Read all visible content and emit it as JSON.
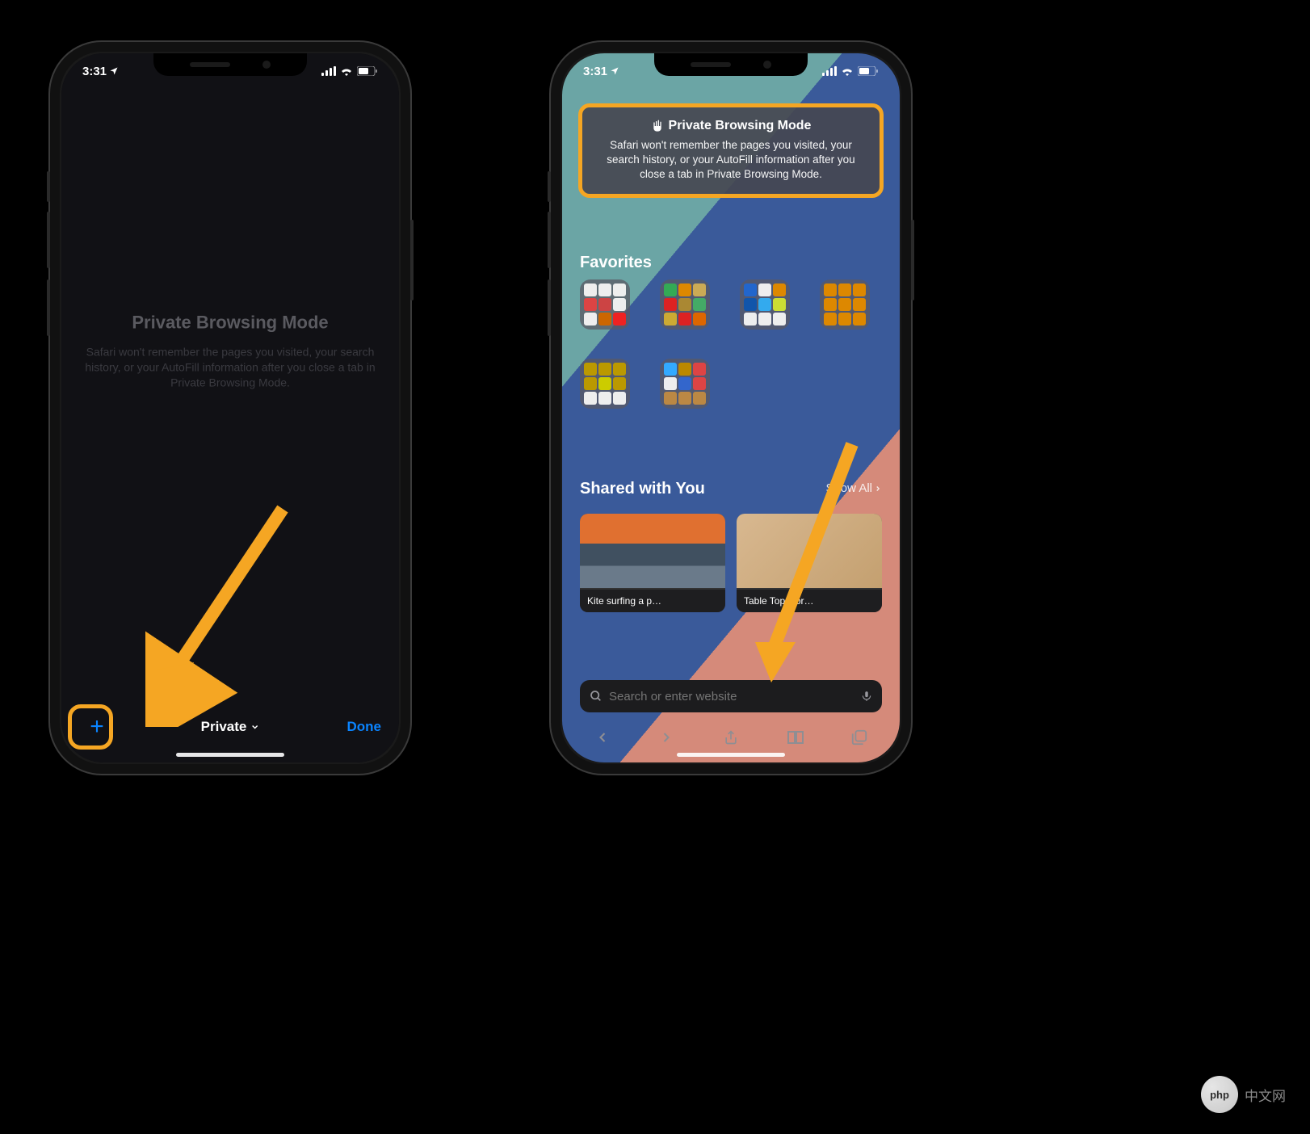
{
  "status": {
    "time": "3:31",
    "location_active": true
  },
  "left": {
    "title": "Private Browsing Mode",
    "description": "Safari won't remember the pages you visited, your search history, or your AutoFill information after you close a tab in Private Browsing Mode.",
    "toolbar": {
      "center_label": "Private",
      "done_label": "Done"
    }
  },
  "right": {
    "private_card": {
      "title": "Private Browsing Mode",
      "text": "Safari won't remember the pages you visited, your search history, or your AutoFill information after you close a tab in Private Browsing Mode."
    },
    "favorites": {
      "header": "Favorites",
      "folders": [
        {
          "name": "folder-1",
          "icons": [
            "#eee",
            "#eee",
            "#eee",
            "#d44",
            "#c44",
            "#eee",
            "#eee",
            "#c60",
            "#e22"
          ]
        },
        {
          "name": "folder-2",
          "icons": [
            "#3a5",
            "#d80",
            "#ca5",
            "#d22",
            "#a83",
            "#4a6",
            "#ca3",
            "#d22",
            "#d60"
          ]
        },
        {
          "name": "folder-3",
          "icons": [
            "#26c",
            "#eee",
            "#d80",
            "#15a",
            "#3ae",
            "#cd3",
            "#eee",
            "#eee",
            "#eee"
          ]
        },
        {
          "name": "folder-4",
          "icons": [
            "#d80",
            "#d80",
            "#d80",
            "#d80",
            "#d80",
            "#d80",
            "#d80",
            "#d80",
            "#d80"
          ]
        },
        {
          "name": "folder-5",
          "icons": [
            "#b90",
            "#b90",
            "#b90",
            "#b90",
            "#cc0",
            "#b90",
            "#eee",
            "#eee",
            "#eee"
          ]
        },
        {
          "name": "folder-6",
          "icons": [
            "#3af",
            "#b80",
            "#d44",
            "#eee",
            "#36c",
            "#d44",
            "#b84",
            "#b84",
            "#b84"
          ]
        }
      ]
    },
    "shared": {
      "header": "Shared with You",
      "action": "Show All",
      "items": [
        {
          "caption": "Kite surfing a p…",
          "bg": "linear-gradient(#e07030 40%,#405060 40%,#405060 70%,#6a7a8a 70%)"
        },
        {
          "caption": "Table Tops for…",
          "bg": "linear-gradient(135deg,#d8b890,#c4a070)"
        }
      ]
    },
    "search": {
      "placeholder": "Search or enter website"
    }
  },
  "colors": {
    "highlight": "#f5a623"
  },
  "watermark": {
    "logo_text": "php",
    "text": "中文网"
  }
}
